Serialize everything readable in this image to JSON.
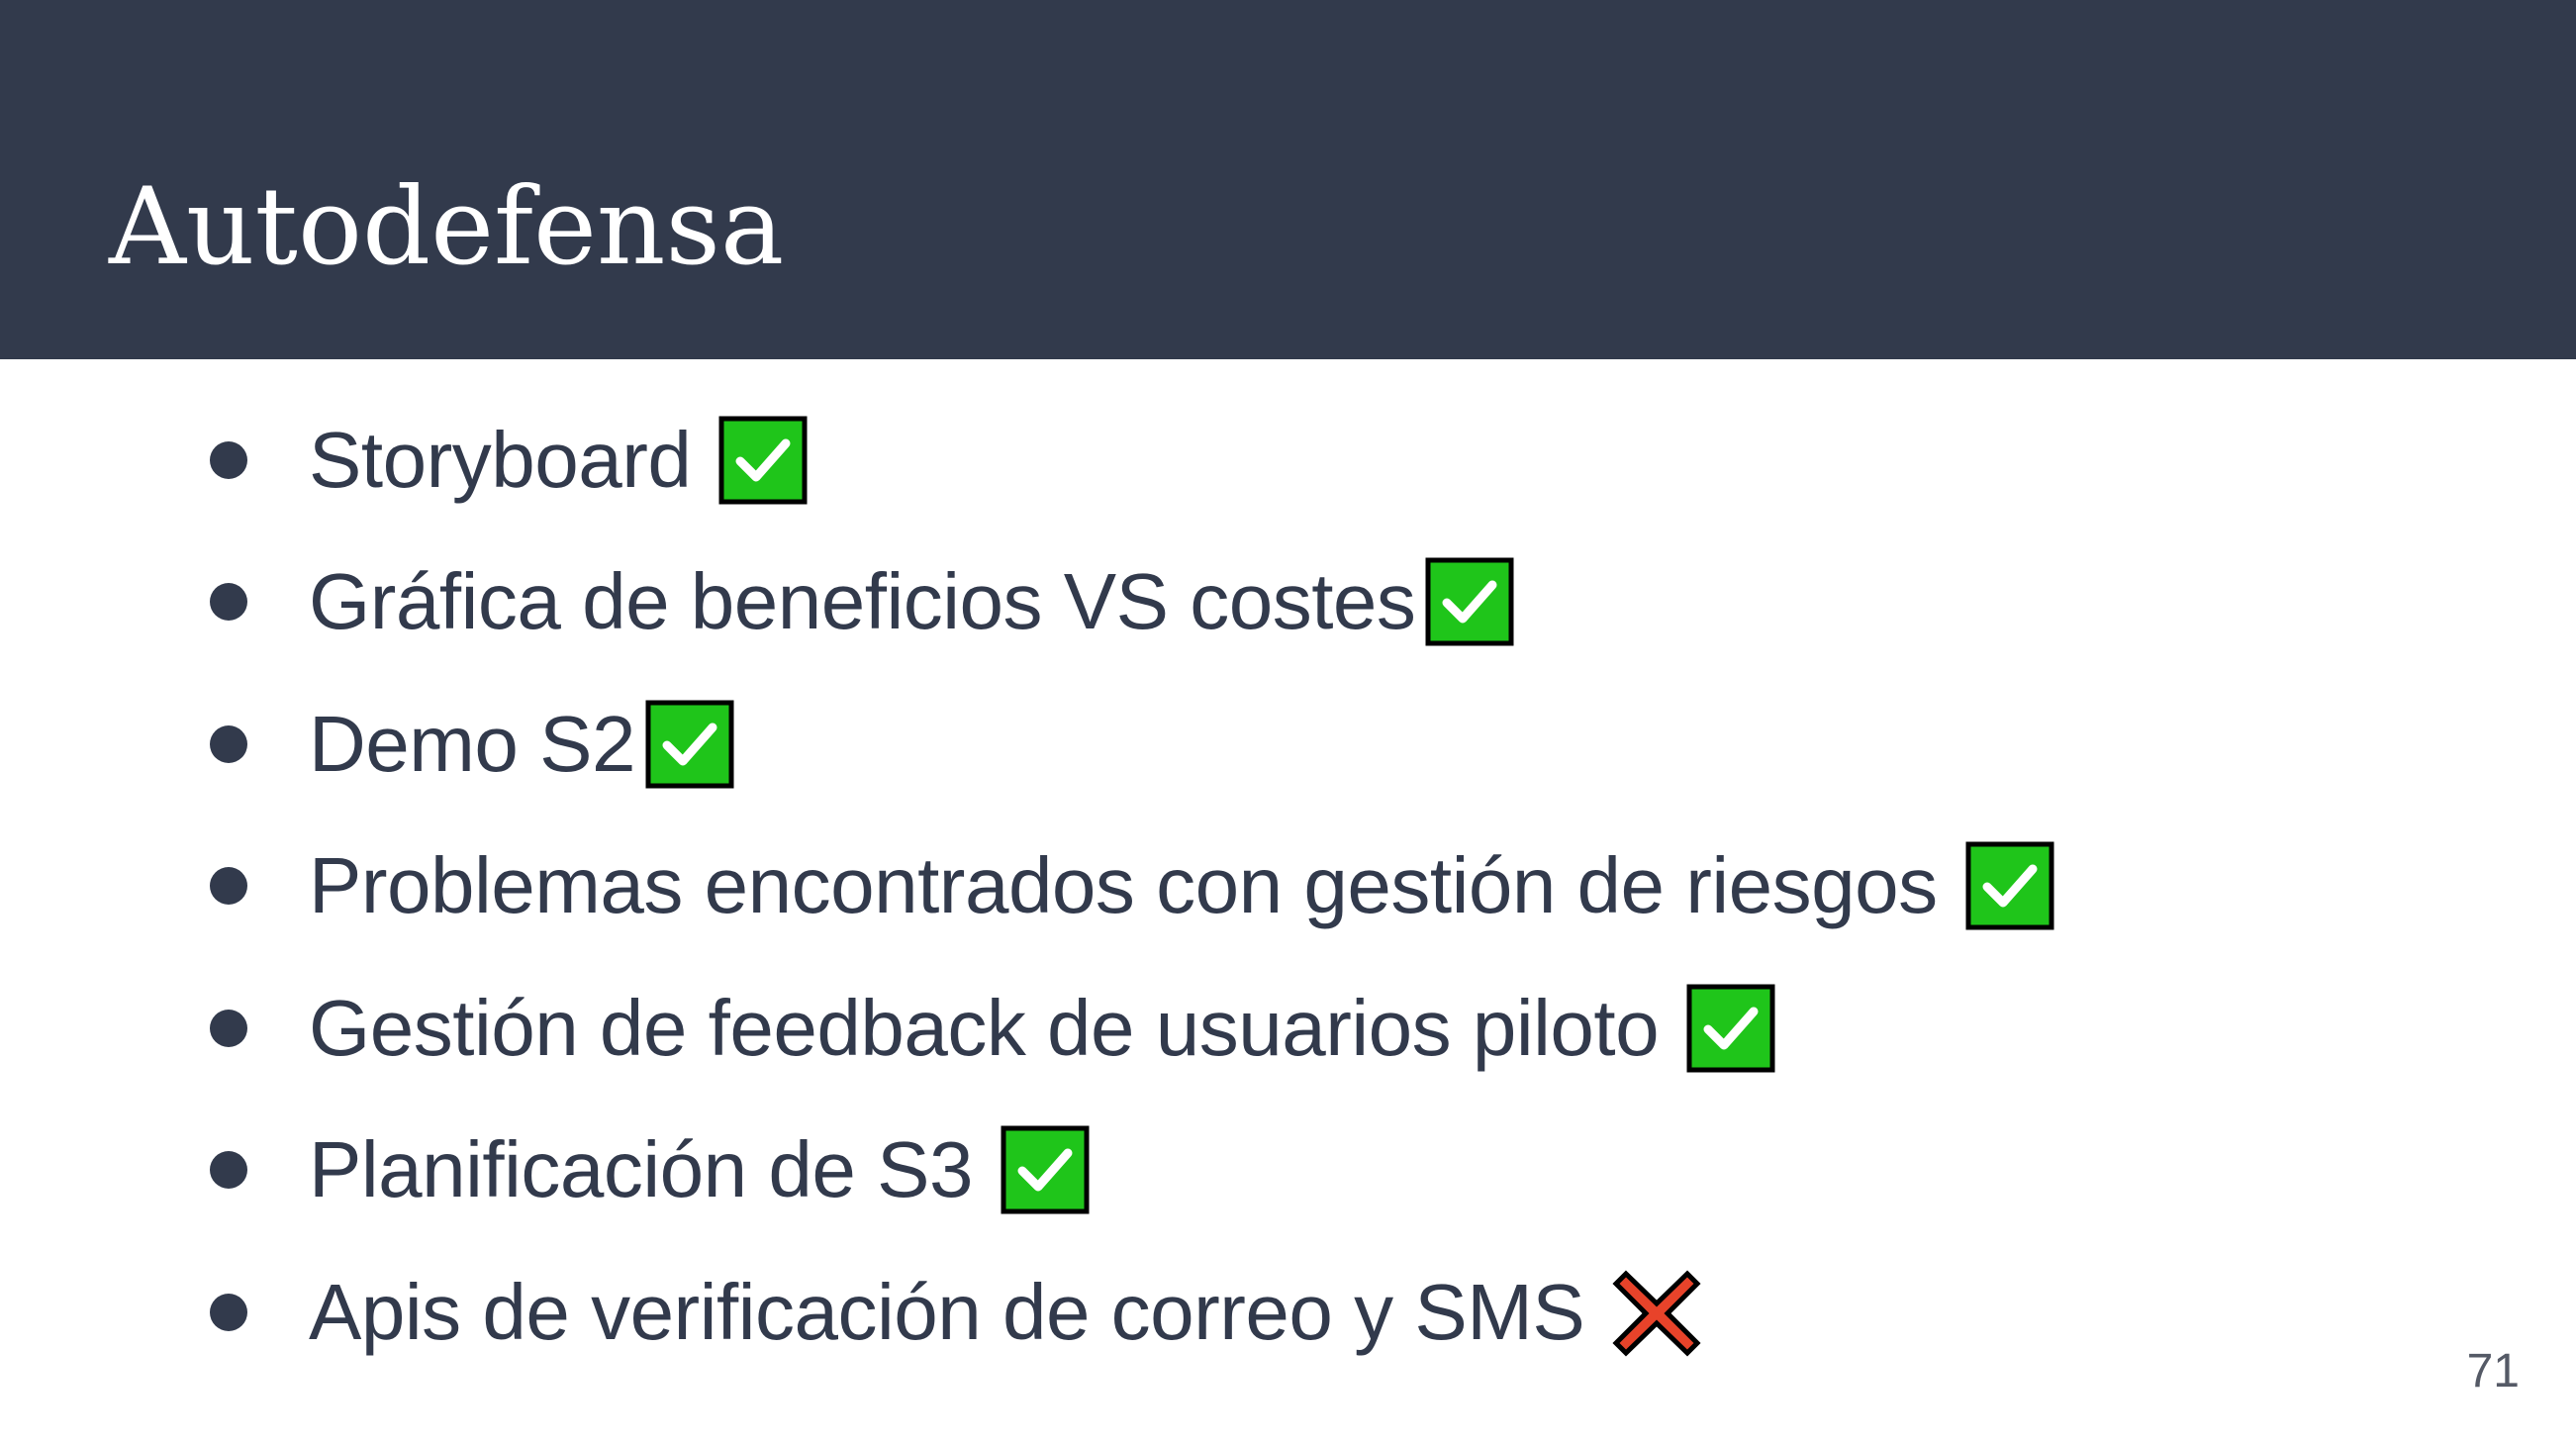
{
  "slide": {
    "title": "Autodefensa",
    "page_number": "71",
    "colors": {
      "header_background": "#323a4c",
      "body_text": "#323a4c",
      "check_green": "#1fc51a",
      "cross_red": "#e8432a"
    },
    "items": [
      {
        "text": "Storyboard",
        "status": "done",
        "icon": "check-box-icon"
      },
      {
        "text": "Gráfica de beneficios VS costes",
        "status": "done",
        "icon": "check-box-icon"
      },
      {
        "text": "Demo S2",
        "status": "done",
        "icon": "check-box-icon"
      },
      {
        "text": "Problemas encontrados con gestión de riesgos",
        "status": "done",
        "icon": "check-box-icon"
      },
      {
        "text": "Gestión de feedback de usuarios piloto",
        "status": "done",
        "icon": "check-box-icon"
      },
      {
        "text": "Planificación de S3",
        "status": "done",
        "icon": "check-box-icon"
      },
      {
        "text": "Apis de verificación de correo y SMS",
        "status": "not-done",
        "icon": "cross-mark-icon"
      }
    ]
  }
}
